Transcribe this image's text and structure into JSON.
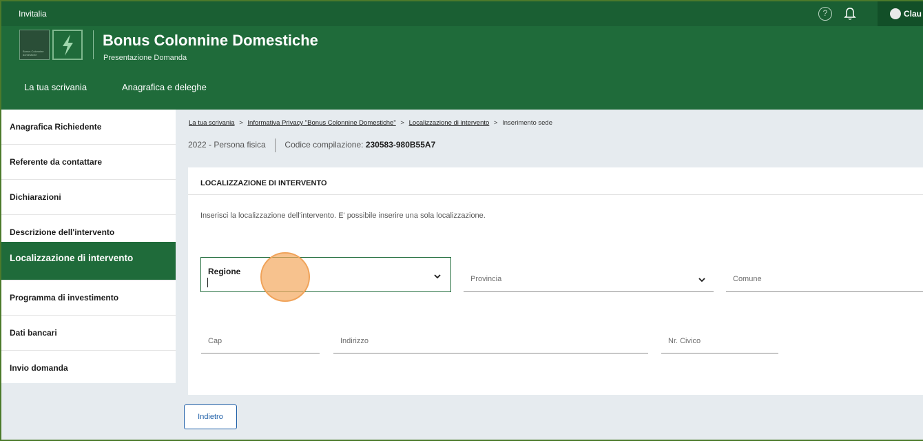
{
  "header": {
    "brand": "Invitalia",
    "user_name": "Clau",
    "logo_text": "Bonus Colonnine domestiche",
    "title": "Bonus Colonnine Domestiche",
    "subtitle": "Presentazione Domanda",
    "nav": [
      "La tua scrivania",
      "Anagrafica e deleghe"
    ]
  },
  "sidebar": {
    "items": [
      {
        "label": "Anagrafica Richiedente"
      },
      {
        "label": "Referente da contattare"
      },
      {
        "label": "Dichiarazioni"
      },
      {
        "label": "Descrizione dell'intervento"
      },
      {
        "label": "Localizzazione di intervento"
      },
      {
        "label": "Programma di investimento"
      },
      {
        "label": "Dati bancari"
      },
      {
        "label": "Invio domanda"
      }
    ],
    "active_index": 4
  },
  "breadcrumb": {
    "items": [
      "La tua scrivania",
      "Informativa Privacy \"Bonus Colonnine Domestiche\"",
      "Localizzazione di intervento"
    ],
    "current": "Inserimento sede",
    "separator": ">"
  },
  "meta": {
    "year_type": "2022 - Persona fisica",
    "code_label": "Codice compilazione:",
    "code_value": "230583-980B55A7"
  },
  "card": {
    "title": "LOCALIZZAZIONE DI INTERVENTO",
    "description": "Inserisci la localizzazione dell'intervento. E' possibile inserire una sola localizzazione."
  },
  "form": {
    "regione": {
      "label": "Regione",
      "value": ""
    },
    "provincia": {
      "label": "Provincia"
    },
    "comune": {
      "label": "Comune"
    },
    "cap": {
      "label": "Cap"
    },
    "indirizzo": {
      "label": "Indirizzo"
    },
    "civico": {
      "label": "Nr. Civico"
    }
  },
  "actions": {
    "back_label": "Indietro"
  },
  "colors": {
    "primary_green": "#1f6b3a",
    "link_blue": "#1e5fa8",
    "click_highlight": "#f4a85e"
  },
  "icons": [
    "help-icon",
    "bell-icon",
    "user-avatar-icon",
    "lightning-icon",
    "chevron-down-icon"
  ]
}
